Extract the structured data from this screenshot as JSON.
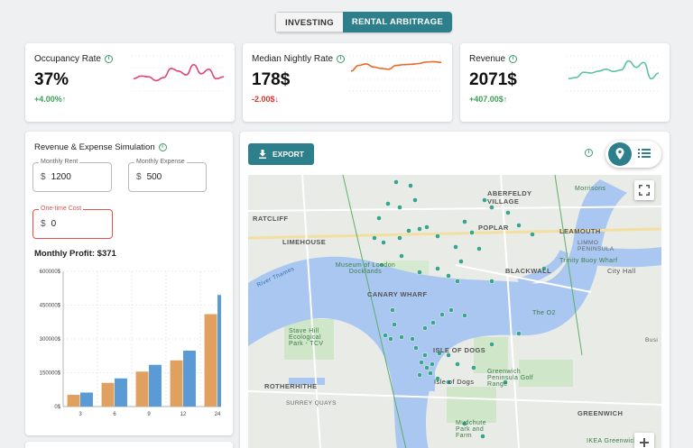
{
  "mode_toggle": {
    "investing": "INVESTING",
    "rental": "RENTAL ARBITRAGE"
  },
  "kpis": [
    {
      "title": "Occupancy Rate",
      "value": "37%",
      "delta": "+4.00%↑",
      "trend": "up",
      "color": "#e0457b",
      "spark": [
        0.35,
        0.42,
        0.4,
        0.3,
        0.38,
        0.62,
        0.55,
        0.45,
        0.72,
        0.48,
        0.6,
        0.35,
        0.4
      ]
    },
    {
      "title": "Median Nightly Rate",
      "value": "178$",
      "delta": "-2.00$↓",
      "trend": "down",
      "color": "#ea6a2a",
      "spark": [
        0.55,
        0.7,
        0.74,
        0.66,
        0.62,
        0.6,
        0.7,
        0.72,
        0.73,
        0.75,
        0.79,
        0.8,
        0.78
      ]
    },
    {
      "title": "Revenue",
      "value": "2071$",
      "delta": "+407.00$↑",
      "trend": "up",
      "color": "#5cc3a3",
      "spark": [
        0.35,
        0.38,
        0.52,
        0.5,
        0.55,
        0.6,
        0.54,
        0.58,
        0.82,
        0.65,
        0.78,
        0.35,
        0.5
      ]
    }
  ],
  "simulation": {
    "title": "Revenue & Expense Simulation",
    "rent_label": "Monthly Rent",
    "rent_currency": "$",
    "rent_value": "1200",
    "expense_label": "Monthly Expense",
    "expense_currency": "$",
    "expense_value": "500",
    "onetime_label": "One-time Cost",
    "onetime_currency": "$",
    "onetime_value": "0",
    "profit_text": "Monthly Profit: $371"
  },
  "chart_data": {
    "type": "bar",
    "title": "",
    "xlabel": "",
    "ylabel": "",
    "ylim": [
      0,
      600000
    ],
    "y_ticks": [
      "0$",
      "150000$",
      "300000$",
      "450000$",
      "600000$"
    ],
    "x_tick_labels": [
      "3",
      "6",
      "9",
      "12",
      "24"
    ],
    "categories": [
      "3",
      "3",
      "6",
      "6",
      "9",
      "9",
      "12",
      "12",
      "24",
      "24"
    ],
    "series": [
      {
        "color": "#e0a060",
        "values": [
          52000,
          105000,
          155000,
          205000,
          410000
        ]
      },
      {
        "color": "#5b9bd5",
        "values": [
          62000,
          125000,
          185000,
          248000,
          495000
        ]
      }
    ]
  },
  "map_panel": {
    "export_label": "EXPORT",
    "labels": [
      "RATCLIFF",
      "LIMEHOUSE",
      "POPLAR",
      "ABERFELDY VILLAGE",
      "LEAMOUTH",
      "LIMMO PENINSULA",
      "CANARY WHARF",
      "BLACKWALL",
      "ROTHERHITHE",
      "ISLE OF DOGS",
      "GREENWICH",
      "SURREY QUAYS"
    ],
    "pois": [
      "Museum of London Docklands",
      "The O2",
      "Trinity Buoy Wharf",
      "Stave Hill Ecological Park - TCV",
      "Isle of Dogs",
      "Greenwich Peninsula Golf Range",
      "Mudchute Park and Farm",
      "City Hall",
      "Morrisons",
      "IKEA Greenwich",
      "River Thames",
      "Busi"
    ]
  }
}
